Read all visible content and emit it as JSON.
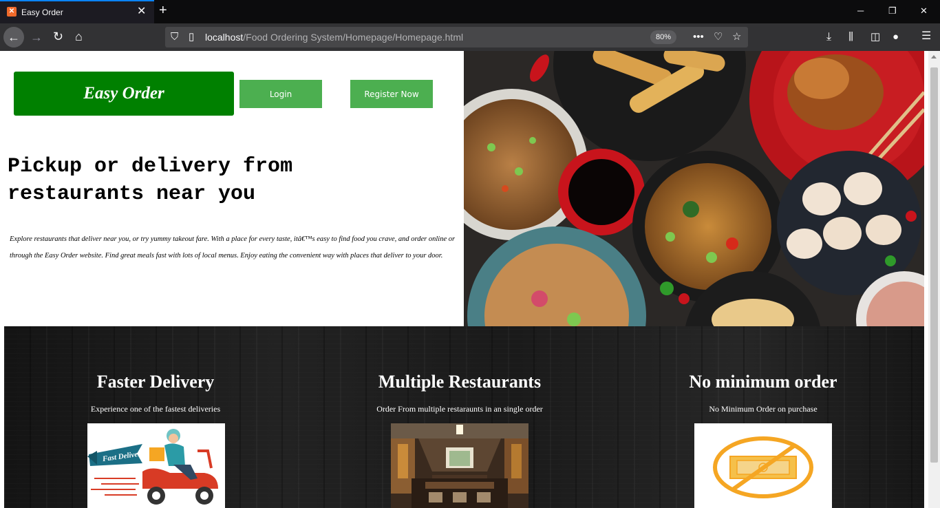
{
  "browser": {
    "tab_title": "Easy Order",
    "url_host": "localhost",
    "url_path": "/Food Ordering System/Homepage/Homepage.html",
    "zoom": "80%"
  },
  "header": {
    "brand": "Easy Order",
    "login_label": "Login",
    "register_label": "Register Now"
  },
  "hero": {
    "title_line1": "Pickup or delivery from",
    "title_line2": "restaurants near you",
    "description": "Explore restaurants that deliver near you, or try yummy takeout fare. With a place for every taste, itâ€™s easy to find food you crave, and order online or through the Easy Order website. Find great meals fast with lots of local menus. Enjoy eating the convenient way with places that deliver to your door."
  },
  "features": [
    {
      "title": "Faster Delivery",
      "subtitle": "Experience one of the fastest deliveries",
      "image_text": "Fast Delivery"
    },
    {
      "title": "Multiple Restaurants",
      "subtitle": "Order From multiple restaraunts in an single order"
    },
    {
      "title": "No minimum order",
      "subtitle": "No Minimum Order on purchase"
    }
  ],
  "colors": {
    "brand_green": "#008000",
    "button_green": "#4caf50",
    "accent_orange": "#f5a623"
  }
}
